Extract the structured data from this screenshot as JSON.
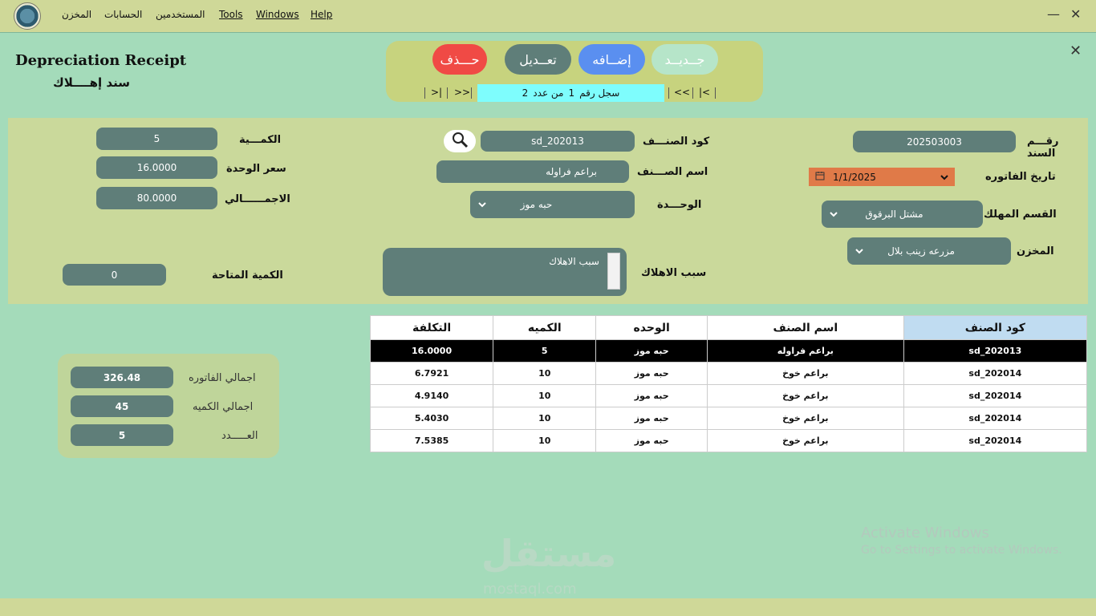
{
  "menu": {
    "store": "المخزن",
    "accounts": "الحسابات",
    "users": "المستخدمين",
    "tools": "Tools",
    "windows": "Windows",
    "help": "Help"
  },
  "window": {
    "minimize": "—",
    "maximize": "☐",
    "close": "✕"
  },
  "header": {
    "title_en": "Depreciation Receipt",
    "title_ar": "سند إهــــلاك",
    "close": "✕"
  },
  "toolbar": {
    "new": "جــديــد",
    "add": "إضــافه",
    "edit": "تعــديل",
    "delete": "حـــذف"
  },
  "navigator": {
    "first": "|<",
    "prev": "<<",
    "next": ">>",
    "last": ">|",
    "record_label": "سجل رقم",
    "record_num": "1",
    "of_label": "من عدد",
    "total": "2"
  },
  "form": {
    "doc_no_label": "رقـــم السند",
    "doc_no": "202503003",
    "invoice_date_label": "تاريخ الفاتوره",
    "invoice_date": "1/1/2025",
    "dept_label": "القسم المهلك",
    "dept": "مشتل البرقوق",
    "store_label": "المخزن",
    "store": "مزرعه زينب بلال",
    "item_code_label": "كود الصنـــف",
    "item_code": "sd_202013",
    "item_name_label": "اسم الصـــنف",
    "item_name": "براعم فراوله",
    "unit_label": "الوحـــدة",
    "unit": "حبه موز",
    "reason_label": "سبب الاهلاك",
    "reason": "سبب الاهلاك",
    "qty_label": "الكمـــية",
    "qty": "5",
    "unit_price_label": "سعر الوحدة",
    "unit_price": "16.0000",
    "total_label": "الاجمــــــالي",
    "total": "80.0000",
    "available_label": "الكمية المتاحة",
    "available": "0"
  },
  "summary": {
    "invoice_total_label": "اجمالي الفاتوره",
    "invoice_total": "326.48",
    "qty_total_label": "اجمالي الكميه",
    "qty_total": "45",
    "count_label": "العـــــدد",
    "count": "5"
  },
  "table": {
    "headers": [
      "كود الصنف",
      "اسم الصنف",
      "الوحده",
      "الكميه",
      "التكلفة"
    ],
    "rows": [
      [
        "sd_202013",
        "براعم فراوله",
        "حبه موز",
        "5",
        "16.0000"
      ],
      [
        "sd_202014",
        "براعم خوخ",
        "حبه موز",
        "10",
        "6.7921"
      ],
      [
        "sd_202014",
        "براعم خوخ",
        "حبه موز",
        "10",
        "4.9140"
      ],
      [
        "sd_202014",
        "براعم خوخ",
        "حبه موز",
        "10",
        "5.4030"
      ],
      [
        "sd_202014",
        "براعم خوخ",
        "حبه موز",
        "10",
        "7.5385"
      ]
    ]
  },
  "overlay": {
    "activate_title": "Activate Windows",
    "activate_sub": "Go to Settings to activate Windows.",
    "brand_ar": "مستقل",
    "brand_en": "mostaql.com"
  },
  "colors": {
    "form_bg": "#a4dbba",
    "frame": "#cfd898",
    "field": "#5f7e79",
    "delete": "#f04a45",
    "add": "#5a8ff0",
    "edit": "#5f7e79",
    "new": "#b6e5c9",
    "date": "#e07a48",
    "record": "#7efdfd"
  }
}
